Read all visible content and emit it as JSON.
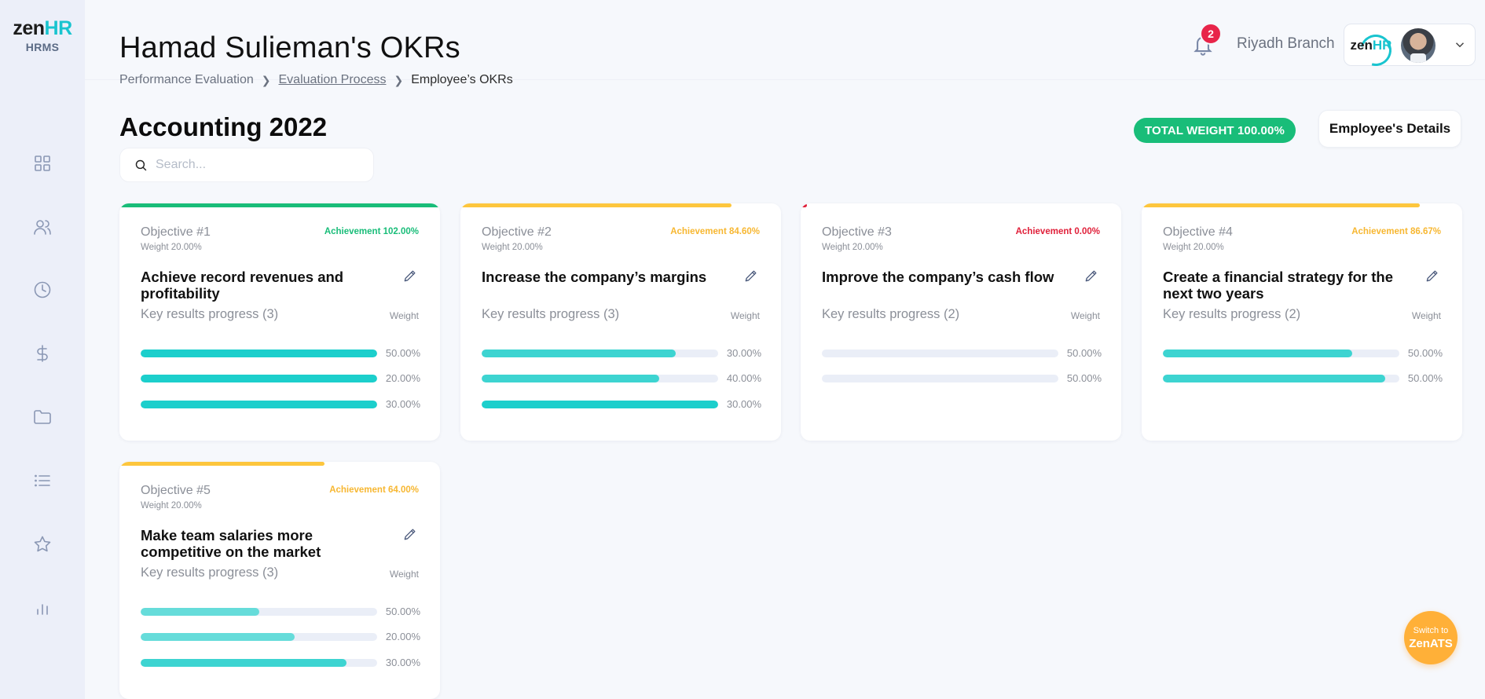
{
  "sidebar": {
    "logo_zen": "zen",
    "logo_hr": "HR",
    "logo_sub": "HRMS",
    "icons": [
      "dashboard-icon",
      "users-icon",
      "clock-icon",
      "dollar-icon",
      "folder-icon",
      "list-icon",
      "star-icon",
      "bar-chart-icon"
    ]
  },
  "header": {
    "title": "Hamad Sulieman's OKRs",
    "breadcrumb": [
      "Performance Evaluation",
      "Evaluation Process",
      "Employee’s OKRs"
    ],
    "notification_count": "2",
    "branch": "Riyadh Branch",
    "profile_logo_zen": "zen",
    "profile_logo_hr": "HR"
  },
  "section": {
    "title": "Accounting 2022",
    "search_placeholder": "Search...",
    "total_weight": "TOTAL WEIGHT 100.00%",
    "details_button": "Employee's Details"
  },
  "colors": {
    "green": "#19bd79",
    "yellow": "#fdc63d",
    "red": "#e0203a",
    "teal": "#1ccfcc"
  },
  "objectives": [
    {
      "label": "Objective #1",
      "weight": "Weight 20.00%",
      "achievement": "Achievement 102.00%",
      "achievement_fraction": 1.0,
      "status_color": "#19bd79",
      "achievement_text_color": "#19bd79",
      "title": "Achieve record revenues and profitability",
      "kr_label": "Key results progress (3)",
      "weight_header": "Weight",
      "key_results": [
        {
          "progress": 1.0,
          "weight": "50.00%"
        },
        {
          "progress": 1.0,
          "weight": "20.00%"
        },
        {
          "progress": 1.0,
          "weight": "30.00%"
        }
      ]
    },
    {
      "label": "Objective #2",
      "weight": "Weight 20.00%",
      "achievement": "Achievement 84.60%",
      "achievement_fraction": 0.846,
      "status_color": "#fdc63d",
      "achievement_text_color": "#f7b731",
      "title": "Increase the company’s margins",
      "kr_label": "Key results progress (3)",
      "weight_header": "Weight",
      "key_results": [
        {
          "progress": 0.82,
          "weight": "30.00%"
        },
        {
          "progress": 0.75,
          "weight": "40.00%"
        },
        {
          "progress": 1.0,
          "weight": "30.00%"
        }
      ]
    },
    {
      "label": "Objective #3",
      "weight": "Weight 20.00%",
      "achievement": "Achievement 0.00%",
      "achievement_fraction": 0.02,
      "status_color": "#e0203a",
      "achievement_text_color": "#e0203a",
      "title": "Improve the company’s cash flow",
      "kr_label": "Key results progress (2)",
      "weight_header": "Weight",
      "key_results": [
        {
          "progress": 0.0,
          "weight": "50.00%"
        },
        {
          "progress": 0.0,
          "weight": "50.00%"
        }
      ]
    },
    {
      "label": "Objective #4",
      "weight": "Weight 20.00%",
      "achievement": "Achievement 86.67%",
      "achievement_fraction": 0.867,
      "status_color": "#fdc63d",
      "achievement_text_color": "#f7b731",
      "title": "Create a financial strategy for the next two years",
      "kr_label": "Key results progress (2)",
      "weight_header": "Weight",
      "key_results": [
        {
          "progress": 0.8,
          "weight": "50.00%"
        },
        {
          "progress": 0.94,
          "weight": "50.00%"
        }
      ]
    },
    {
      "label": "Objective #5",
      "weight": "Weight 20.00%",
      "achievement": "Achievement 64.00%",
      "achievement_fraction": 0.64,
      "status_color": "#fdc63d",
      "achievement_text_color": "#f7b731",
      "title": "Make team salaries more competitive on the market",
      "kr_label": "Key results progress (3)",
      "weight_header": "Weight",
      "key_results": [
        {
          "progress": 0.5,
          "weight": "50.00%"
        },
        {
          "progress": 0.65,
          "weight": "20.00%"
        },
        {
          "progress": 0.87,
          "weight": "30.00%"
        }
      ]
    }
  ],
  "fab": {
    "line1": "Switch to",
    "line2": "ZenATS"
  }
}
